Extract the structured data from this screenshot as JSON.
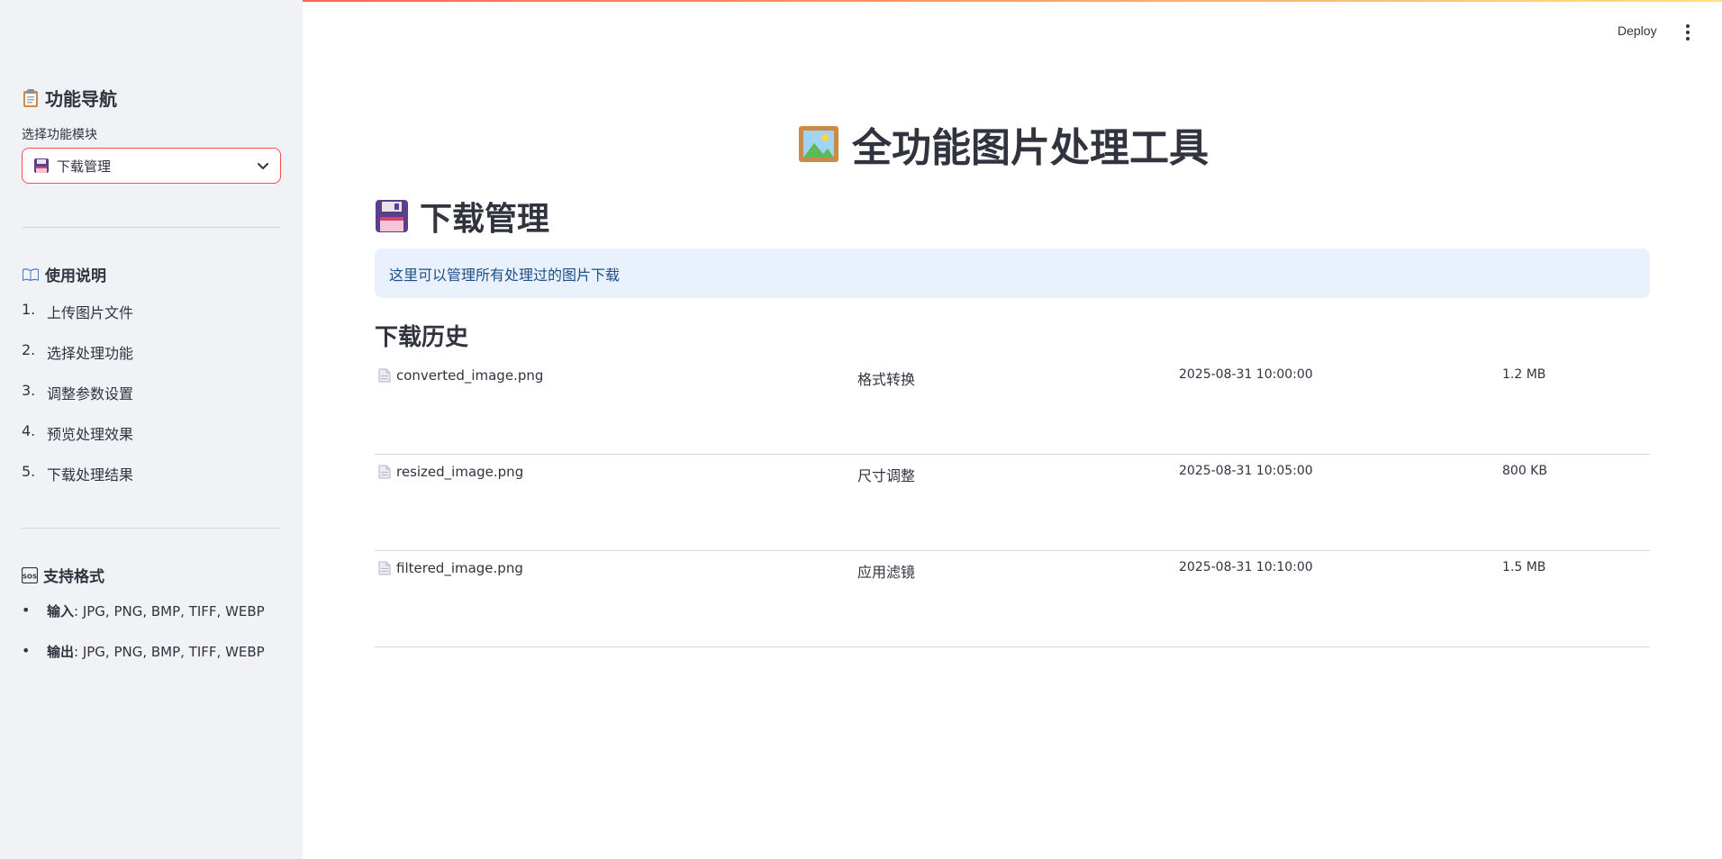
{
  "header": {
    "deploy_label": "Deploy"
  },
  "sidebar": {
    "nav_title": "功能导航",
    "select_label": "选择功能模块",
    "selected_value": "下载管理",
    "usage_title": "使用说明",
    "steps": [
      {
        "num": "1.",
        "label": "上传图片文件"
      },
      {
        "num": "2.",
        "label": "选择处理功能"
      },
      {
        "num": "3.",
        "label": "调整参数设置"
      },
      {
        "num": "4.",
        "label": "预览处理效果"
      },
      {
        "num": "5.",
        "label": "下载处理结果"
      }
    ],
    "formats_title": "支持格式",
    "formats": [
      {
        "label": "输入",
        "value": ": JPG, PNG, BMP, TIFF, WEBP"
      },
      {
        "label": "输出",
        "value": ": JPG, PNG, BMP, TIFF, WEBP"
      }
    ]
  },
  "main": {
    "app_title": "全功能图片处理工具",
    "section_title": "下载管理",
    "info_text": "这里可以管理所有处理过的图片下载",
    "history_title": "下载历史",
    "history": [
      {
        "file": "converted_image.png",
        "operation": "格式转换",
        "time": "2025-08-31 10:00:00",
        "size": "1.2 MB"
      },
      {
        "file": "resized_image.png",
        "operation": "尺寸调整",
        "time": "2025-08-31 10:05:00",
        "size": "800 KB"
      },
      {
        "file": "filtered_image.png",
        "operation": "应用滤镜",
        "time": "2025-08-31 10:10:00",
        "size": "1.5 MB"
      }
    ]
  },
  "colors": {
    "accent": "#ff4b4b",
    "sidebar_bg": "#f0f2f6",
    "info_bg": "#e8f1fc",
    "info_text": "#1d4f8a",
    "text": "#31333f"
  }
}
